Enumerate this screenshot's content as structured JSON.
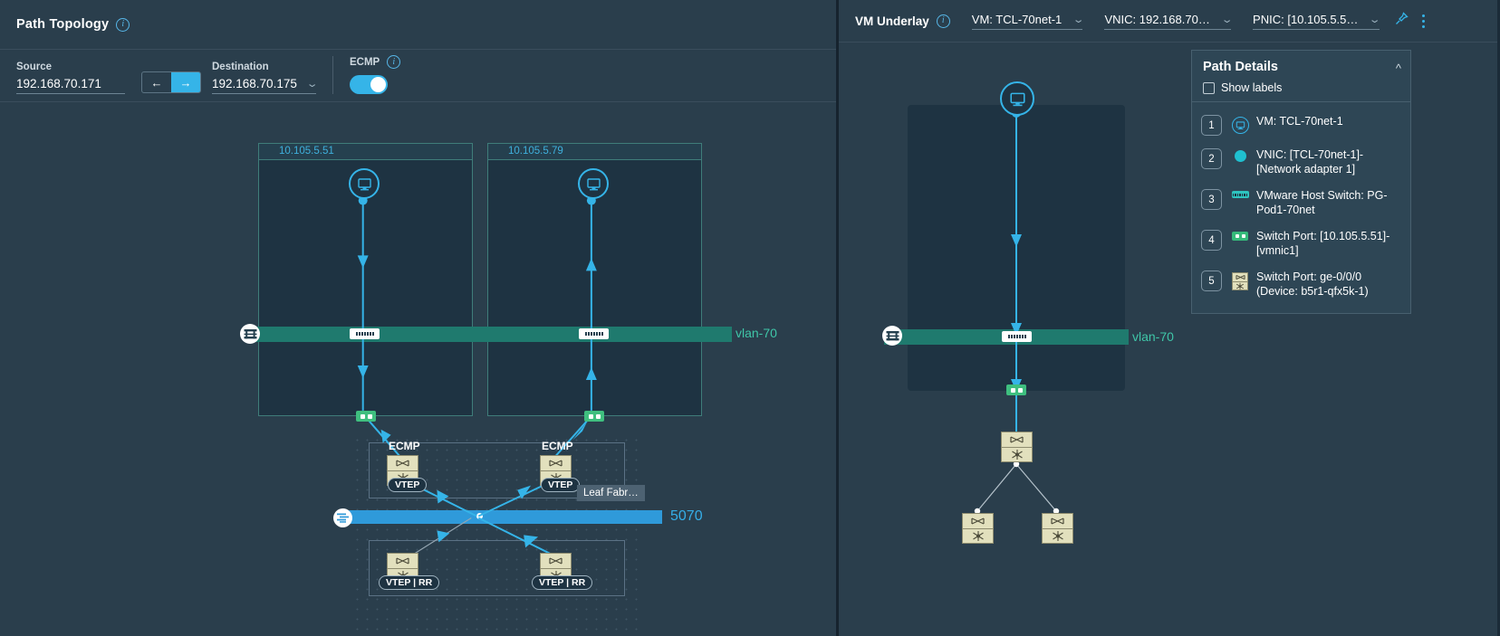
{
  "left": {
    "title": "Path Topology",
    "info_icon": "info-icon",
    "source": {
      "label": "Source",
      "value": "192.168.70.171"
    },
    "destination": {
      "label": "Destination",
      "value": "192.168.70.175"
    },
    "direction": {
      "back": "←",
      "forward": "→",
      "active": "forward"
    },
    "ecmp": {
      "label": "ECMP",
      "enabled": true
    },
    "hosts": [
      {
        "ip": "10.105.5.51"
      },
      {
        "ip": "10.105.5.79"
      }
    ],
    "vlan_label": "vlan-70",
    "link_label": "5070",
    "ecmp_tags": [
      "ECMP",
      "ECMP"
    ],
    "vtep_caps": [
      "VTEP",
      "VTEP"
    ],
    "vteprr_caps": [
      "VTEP | RR",
      "VTEP | RR"
    ],
    "fabric_tags": [
      "Leaf Fabr…"
    ]
  },
  "right": {
    "title": "VM Underlay",
    "selects": [
      {
        "name": "vm-select",
        "text": "VM: TCL-70net-1"
      },
      {
        "name": "vnic-select",
        "text": "VNIC: 192.168.70…"
      },
      {
        "name": "pnic-select",
        "text": "PNIC: [10.105.5.5…"
      }
    ],
    "pin_icon": "pin-icon",
    "menu_icon": "kebab-menu-icon",
    "vlan_label": "vlan-70",
    "details": {
      "title": "Path Details",
      "collapse_icon": "chevron-up-icon",
      "show_labels": "Show labels",
      "show_labels_checked": false,
      "steps": [
        {
          "num": "1",
          "icon": "vm-icon",
          "text": "VM: TCL-70net-1"
        },
        {
          "num": "2",
          "icon": "vnic-dot-icon",
          "text": "VNIC: [TCL-70net-1]-[Network adapter 1]"
        },
        {
          "num": "3",
          "icon": "host-switch-icon",
          "text": "VMware Host Switch: PG-Pod1-70net"
        },
        {
          "num": "4",
          "icon": "switch-port-icon",
          "text": "Switch Port: [10.105.5.51]-[vmnic1]"
        },
        {
          "num": "5",
          "icon": "router-icon",
          "text": "Switch Port: ge-0/0/0 (Device: b5r1-qfx5k-1)"
        }
      ]
    }
  },
  "colors": {
    "panel_bg": "#2a3e4c",
    "canvas_bg": "#2a3e4c",
    "host_bg": "#1e3342",
    "accent_blue": "#35b4e8",
    "vlan_green": "#1f7a6e",
    "vlan_text": "#3fc6a8",
    "link_blue": "#2f9ada",
    "router_tan": "#e2e0bd",
    "port_green": "#3fbf7f"
  }
}
